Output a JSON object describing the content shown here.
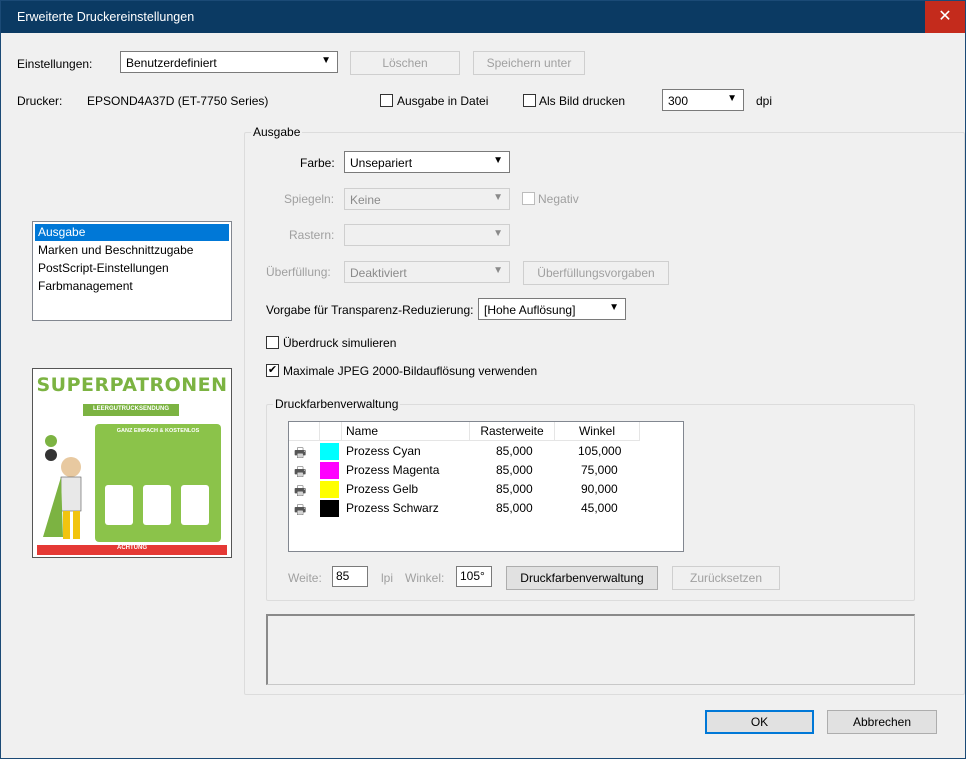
{
  "window": {
    "title": "Erweiterte Druckereinstellungen",
    "close": "✕"
  },
  "top": {
    "settings_label": "Einstellungen:",
    "settings_value": "Benutzerdefiniert",
    "delete_button": "Löschen",
    "save_as_button": "Speichern unter",
    "printer_label": "Drucker:",
    "printer_value": "EPSOND4A37D (ET-7750 Series)",
    "output_to_file": "Ausgabe in Datei",
    "print_as_image": "Als Bild drucken",
    "dpi_value": "300",
    "dpi_unit": "dpi"
  },
  "nav": {
    "items": [
      "Ausgabe",
      "Marken und Beschnittzugabe",
      "PostScript-Einstellungen",
      "Farbmanagement"
    ],
    "selected": 0
  },
  "preview": {
    "logo_text": "SUPERPATRONEN",
    "subtitle": "LEERGUTRÜCKSENDUNG",
    "heading": "GANZ EINFACH & KOSTENLOS",
    "footer": "ACHTUNG"
  },
  "output": {
    "group_label": "Ausgabe",
    "color_label": "Farbe:",
    "color_value": "Unsepariert",
    "mirror_label": "Spiegeln:",
    "mirror_value": "Keine",
    "negative_label": "Negativ",
    "screen_label": "Rastern:",
    "screen_value": "",
    "trapping_label": "Überfüllung:",
    "trapping_value": "Deaktiviert",
    "trapping_presets_button": "Überfüllungsvorgaben",
    "flattener_label": "Vorgabe für Transparenz-Reduzierung:",
    "flattener_value": "[Hohe Auflösung]",
    "simulate_overprint": "Überdruck simulieren",
    "simulate_overprint_checked": false,
    "max_jpeg": "Maximale JPEG 2000-Bildauflösung verwenden",
    "max_jpeg_checked": true
  },
  "ink_manager": {
    "group_label": "Druckfarbenverwaltung",
    "columns": [
      "Name",
      "Rasterweite",
      "Winkel"
    ],
    "rows": [
      {
        "name": "Prozess Cyan",
        "frequency": "85,000",
        "angle": "105,000",
        "color": "#00ffff"
      },
      {
        "name": "Prozess Magenta",
        "frequency": "85,000",
        "angle": "75,000",
        "color": "#ff00ff"
      },
      {
        "name": "Prozess Gelb",
        "frequency": "85,000",
        "angle": "90,000",
        "color": "#ffff00"
      },
      {
        "name": "Prozess Schwarz",
        "frequency": "85,000",
        "angle": "45,000",
        "color": "#000000"
      }
    ],
    "frequency_label": "Weite:",
    "frequency_value": "85",
    "frequency_unit": "lpi",
    "angle_label": "Winkel:",
    "angle_value": "105°",
    "ink_manager_button": "Druckfarbenverwaltung",
    "reset_button": "Zurücksetzen"
  },
  "footer": {
    "ok": "OK",
    "cancel": "Abbrechen"
  }
}
